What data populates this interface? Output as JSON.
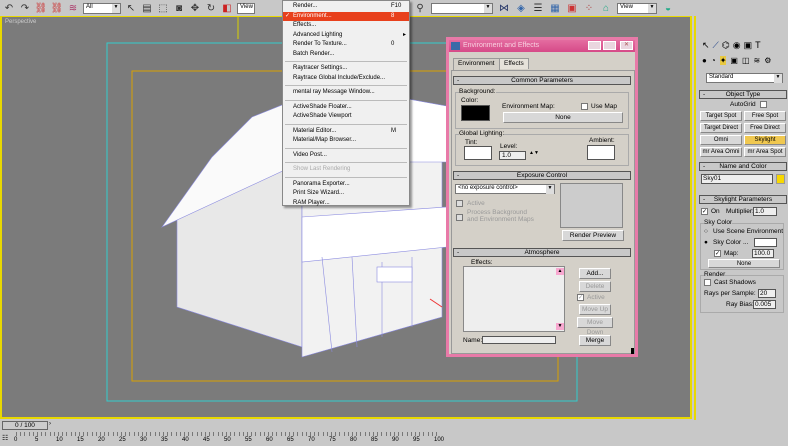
{
  "toolbar": {
    "selection_filter": "All",
    "ref_coord": "View",
    "named_selection": "",
    "view_dropdown": "View",
    "icons": [
      "undo-icon",
      "redo-icon",
      "select-link-icon",
      "unlink-icon",
      "bind-space-warp-icon",
      "select-icon",
      "select-by-name-icon",
      "rect-selection-icon",
      "window-crossing-icon",
      "move-icon",
      "rotate-icon",
      "scale-icon",
      "pivot-icon",
      "mirror-icon",
      "align-icon",
      "layer-manager-icon",
      "curve-editor-icon",
      "schematic-view-icon",
      "material-editor-icon",
      "render-scene-icon",
      "quick-render-icon"
    ]
  },
  "viewport": {
    "label": "Perspective"
  },
  "render_menu": {
    "items": [
      {
        "label": "Render...",
        "shortcut": "F10"
      },
      {
        "label": "Environment...",
        "shortcut": "8",
        "checked": true,
        "highlighted": true
      },
      {
        "label": "Effects..."
      },
      {
        "label": "Advanced Lighting",
        "submenu": true
      },
      {
        "label": "Render To Texture...",
        "shortcut": "0"
      },
      {
        "label": "Batch Render..."
      },
      {
        "separator": true
      },
      {
        "label": "Raytracer Settings..."
      },
      {
        "label": "Raytrace Global Include/Exclude..."
      },
      {
        "separator": true
      },
      {
        "label": "mental ray Message Window..."
      },
      {
        "separator": true
      },
      {
        "label": "ActiveShade Floater..."
      },
      {
        "label": "ActiveShade Viewport"
      },
      {
        "separator": true
      },
      {
        "label": "Material Editor...",
        "shortcut": "M"
      },
      {
        "label": "Material/Map Browser..."
      },
      {
        "separator": true
      },
      {
        "label": "Video Post..."
      },
      {
        "separator": true
      },
      {
        "label": "Show Last Rendering",
        "disabled": true
      },
      {
        "separator": true
      },
      {
        "label": "Panorama Exporter..."
      },
      {
        "label": "Print Size Wizard..."
      },
      {
        "label": "RAM Player..."
      }
    ]
  },
  "dialog": {
    "title": "Environment and Effects",
    "tabs": [
      "Environment",
      "Effects"
    ],
    "common": {
      "header": "Common Parameters",
      "background": "Background:",
      "color": "Color:",
      "color_value": "#000000",
      "env_map": "Environment Map:",
      "use_map": "Use Map",
      "map_button": "None",
      "global_lighting": "Global Lighting:",
      "tint": "Tint:",
      "level": "Level:",
      "level_value": "1.0",
      "ambient": "Ambient:"
    },
    "exposure": {
      "header": "Exposure Control",
      "dropdown": "<no exposure control>",
      "active": "Active",
      "process": "Process Background and Environment Maps",
      "render_preview": "Render Preview"
    },
    "atmosphere": {
      "header": "Atmosphere",
      "effects": "Effects:",
      "add": "Add...",
      "delete": "Delete",
      "active": "Active",
      "move_up": "Move Up",
      "move_down": "Move Down",
      "name": "Name:",
      "name_value": "",
      "merge": "Merge"
    }
  },
  "panel": {
    "dropdown": "Standard",
    "object_type": {
      "header": "Object Type",
      "autogrid": "AutoGrid",
      "buttons": [
        "Target Spot",
        "Free Spot",
        "Target Direct",
        "Free Direct",
        "Omni",
        "Skylight",
        "mr Area Omni",
        "mr Area Spot"
      ],
      "active": "Skylight"
    },
    "name_color": {
      "header": "Name and Color",
      "name": "Sky01",
      "color": "#f8d800"
    },
    "skylight": {
      "header": "Skylight Parameters",
      "on": "On",
      "multiplier": "Multiplier:",
      "multiplier_value": "1.0",
      "sky_color": "Sky Color",
      "use_scene": "Use Scene Environment",
      "sky_color_opt": "Sky Color ...",
      "map": "Map:",
      "map_value": "100.0",
      "none": "None",
      "render": "Render",
      "cast_shadows": "Cast Shadows",
      "rays": "Rays per Sample:",
      "rays_value": "20",
      "ray_bias": "Ray Bias:",
      "ray_bias_value": "0.005"
    }
  },
  "timeline": {
    "frame": "0 / 100",
    "ticks": [
      "0",
      "5",
      "10",
      "15",
      "20",
      "25",
      "30",
      "35",
      "40",
      "45",
      "50",
      "55",
      "60",
      "65",
      "70",
      "75",
      "80",
      "85",
      "90",
      "95",
      "100"
    ]
  },
  "accent": "#e8401c"
}
